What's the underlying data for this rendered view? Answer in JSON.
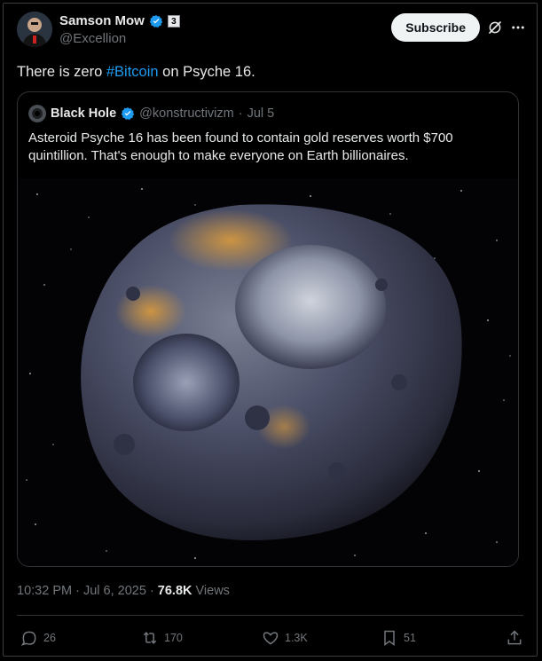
{
  "author": {
    "display_name": "Samson Mow",
    "handle": "@Excellion",
    "badge_label": "3"
  },
  "subscribe_label": "Subscribe",
  "tweet": {
    "text_before": "There is zero ",
    "hashtag": "#Bitcoin",
    "text_after": " on Psyche 16."
  },
  "quote": {
    "display_name": "Black Hole",
    "handle": "@konstructivizm",
    "separator": "·",
    "date": "Jul 5",
    "text": "Asteroid Psyche 16 has been found to contain gold reserves worth $700 quintillion. That's enough to make everyone on Earth billionaires."
  },
  "meta": {
    "time_date": "10:32 PM · Jul 6, 2025 · ",
    "views_count": "76.8K",
    "views_label": " Views"
  },
  "actions": {
    "replies": "26",
    "reposts": "170",
    "likes": "1.3K",
    "bookmarks": "51"
  },
  "colors": {
    "accent": "#1d9bf0",
    "muted": "#71767b",
    "text": "#e7e9ea",
    "border": "#2f3336"
  }
}
